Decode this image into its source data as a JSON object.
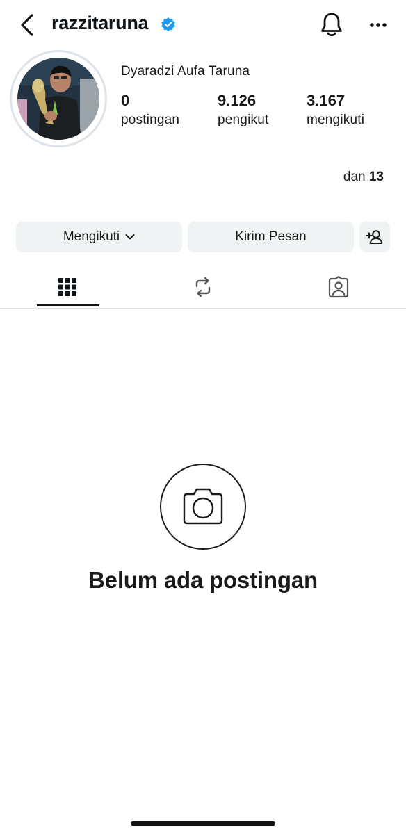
{
  "header": {
    "username": "razzitaruna",
    "verified_color": "#1d9bf0",
    "icons": {
      "back": "chevron-left-icon",
      "verified": "verified-badge-icon",
      "notifications": "bell-icon",
      "more": "more-dots-icon"
    }
  },
  "profile": {
    "display_name": "Dyaradzi Aufa Taruna",
    "stats": [
      {
        "value": "0",
        "label": "postingan"
      },
      {
        "value": "9.126",
        "label": "pengikut"
      },
      {
        "value": "3.167",
        "label": "mengikuti"
      }
    ],
    "mutual_prefix": "dan",
    "mutual_count": "13"
  },
  "actions": {
    "following_label": "Mengikuti",
    "message_label": "Kirim Pesan",
    "icons": {
      "following": "chevron-down-icon",
      "add_user": "add-user-icon"
    }
  },
  "tabs": [
    {
      "icon": "grid-icon",
      "active": true
    },
    {
      "icon": "repost-icon",
      "active": false
    },
    {
      "icon": "tagged-person-icon",
      "active": false
    }
  ],
  "empty_state": {
    "icon": "camera-icon",
    "title": "Belum ada postingan"
  },
  "colors": {
    "button_bg": "#eff3f4",
    "text": "#1a1a1a",
    "divider": "#dfe3e6"
  }
}
